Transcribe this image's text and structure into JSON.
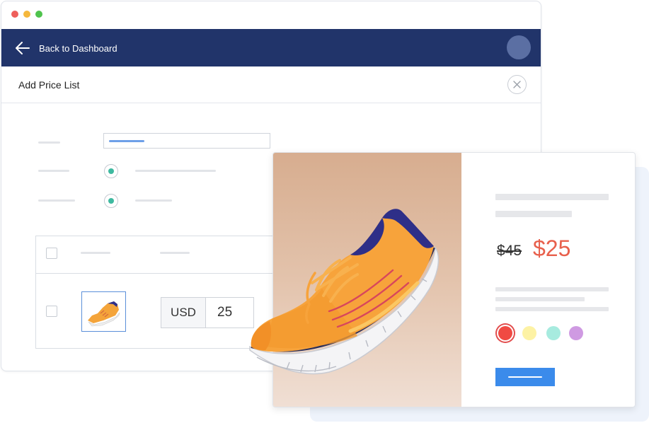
{
  "window": {
    "traffic_lights": [
      "#ee5f5b",
      "#f5b83d",
      "#4fc34d"
    ]
  },
  "navbar": {
    "back_label": "Back to Dashboard",
    "background": "#21346a",
    "avatar_color": "#5b6fa3"
  },
  "page": {
    "title": "Add Price List",
    "close_icon": "close-icon"
  },
  "form": {
    "radio_accent": "#3eb9a0",
    "input_accent": "#6ea0e8"
  },
  "table": {
    "row": {
      "currency": "USD",
      "amount": "25"
    }
  },
  "product_card": {
    "old_price": "$45",
    "new_price": "$25",
    "price_color": "#e8604c",
    "swatches": [
      {
        "name": "red",
        "color": "#f04a43",
        "selected": true
      },
      {
        "name": "yellow",
        "color": "#fdf2a4",
        "selected": false
      },
      {
        "name": "teal",
        "color": "#a7ebdf",
        "selected": false
      },
      {
        "name": "purple",
        "color": "#cf9ae2",
        "selected": false
      }
    ],
    "button_color": "#3b8beb"
  }
}
